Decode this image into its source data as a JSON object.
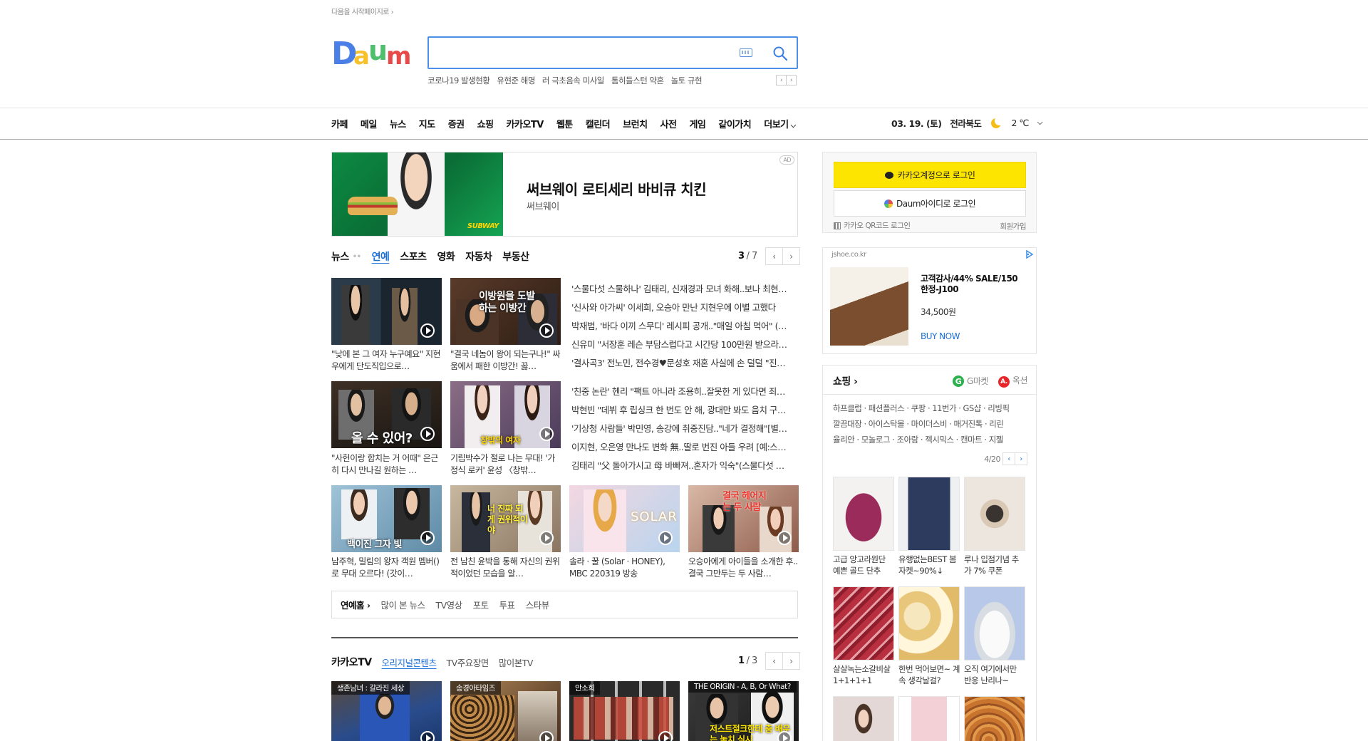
{
  "top": {
    "homepage_link": "다음을 시작페이지로 ›",
    "logo_text": "Daum",
    "search_placeholder": ""
  },
  "trending": [
    "코로나19 발생현황",
    "유현준 해명",
    "러 극초음속 미사일",
    "톰히들스턴 약혼",
    "놀토 규현"
  ],
  "gnb": [
    "카페",
    "메일",
    "뉴스",
    "지도",
    "증권",
    "쇼핑",
    "카카오TV",
    "웹툰",
    "캘린더",
    "브런치",
    "사전",
    "게임",
    "같이가치",
    "더보기"
  ],
  "weather": {
    "date": "03. 19. (토)",
    "region": "전라북도",
    "temp": "2 ℃"
  },
  "ad": {
    "title": "써브웨이 로티세리 바비큐 치킨",
    "sub": "써브웨이",
    "badge": "AD",
    "logo": "SUBWAY"
  },
  "news": {
    "tabs": [
      "뉴스",
      "연예",
      "스포츠",
      "영화",
      "자동차",
      "부동산"
    ],
    "active_tab": "연예",
    "page_current": "3",
    "page_total": "/ 7",
    "cards_row1": [
      {
        "caption": "\"낮에 본 그 여자 누구예요\" 지현우에게 단도직입으로…"
      },
      {
        "caption": "\"결국 네놈이 왕이 되는구나!\" 싸움에서 패한 이방간! 꿇…"
      }
    ],
    "cards_row2": [
      {
        "caption": "\"사헌이랑 합치는 거 어때\" 은근히 다시 만나길 원하는 …"
      },
      {
        "caption": "기립박수가 절로 나는 무대! '가정식 로커' 윤성 〈창밖…"
      }
    ],
    "headlines_a": [
      "'스물다섯 스물하나' 김태리, 신재경과 모녀 화해..보나 최현…",
      "'신사와 아가씨' 이세희, 오승아 만난 지현우에 이별 고했다",
      "박재범, '바다 이끼 스무디' 레시피 공개..\"매일 아침 먹어\" (…",
      "신유미 \"서장훈 레슨 부담스럽다고 시간당 100만원 받으라…",
      "'결사곡3' 전노민, 전수경♥문성호 재혼 사실에 손 덜덜 \"진…"
    ],
    "headlines_b": [
      "'친중 논란' 헨리 \"팩트 아니라 조용히..잘못한 게 있다면 죄…",
      "박현빈 \"데뷔 후 립싱크 한 번도 안 해, 광대만 봐도 음치 구…",
      "'기상청 사람들' 박민영, 송강에 취중진담..\"네가 결정해\"[별…",
      "이지현, 오은영 만나도 변화 無..딸로 번진 아들 우려 [예:스…",
      "김태리 \"父 돌아가시고 母 바빠져..혼자가 익숙\"(스물다섯 …"
    ],
    "cards_row3": [
      {
        "caption": "남주혁, 밀림의 왕자 객원 멤버()로 무대 오르다! (갓이…"
      },
      {
        "caption": "전 남친 윤박을 통해 자신의 권위적이었던 모습을 알…"
      },
      {
        "caption": "솔라 · 꿀 (Solar · HONEY), MBC 220319 방송"
      },
      {
        "caption": "오승아에게 아이들을 소개한 후.. 결국 그만두는 두 사람…"
      }
    ],
    "thumb_texts": [
      "이방원을 도발하는 이방간",
      "올 수 있어?",
      "창밖의 여자",
      "백이진 그자 빛",
      "너 진짜 되게 권위적이야",
      "SOLAR",
      "결국 헤어지는 두 사람"
    ]
  },
  "ent_bar": [
    "연예홈 ›",
    "많이 본 뉴스",
    "TV영상",
    "포토",
    "투표",
    "스타뷰"
  ],
  "kakaotv": {
    "title": "카카오TV",
    "tabs": [
      "오리지널콘텐츠",
      "TV주요장면",
      "많이본TV"
    ],
    "page_current": "1",
    "page_total": "/ 3",
    "thumbs": [
      "생존남녀 : 갈라진 세상",
      "송경아타임즈",
      "안소희",
      "THE ORIGIN - A, B, Or What?"
    ],
    "thumb_text": "저스트절크한테 춤 배우는 놓치 실시"
  },
  "login": {
    "kakao": "카카오계정으로 로그인",
    "daum": "Daum아이디로 로그인",
    "qr": "카카오 QR코드 로그인",
    "signup": "회원가입"
  },
  "right_ad": {
    "domain": "jshoe.co.kr",
    "title": "고객감사/44% SALE/150 한정-J100",
    "price": "34,500원",
    "buy": "BUY NOW"
  },
  "shopping": {
    "title": "쇼핑 ›",
    "gmarket": "G마켓",
    "auction": "옥션",
    "rows": [
      "하프클럽 · 패션플러스 · 쿠팡 · 11번가 · GS샵 · 리빙픽",
      "깔끔대장 · 아이스탁몰 · 마이더스비 · 매거진톡 · 리린",
      "율리안 · 모놀로그 · 조아람 · 젝시믹스 · 캔마트 · 지젤"
    ],
    "page": "4/20",
    "products": [
      {
        "caption": "고급 앙고라원단 예쁜 골드 단추",
        "color": "#9b2b5a"
      },
      {
        "caption": "유행없는BEST 봄자켓~90%↓",
        "color": "#2d3b5e"
      },
      {
        "caption": "루나 입점기념 추가 7% 쿠폰",
        "color": "#e4ddd3"
      },
      {
        "caption": "살살녹는소갈비살 1+1+1+1",
        "color": "#b8303f"
      },
      {
        "caption": "한번 먹어보면~ 계속 생각날걸?",
        "color": "#e8c77a"
      },
      {
        "caption": "오직 여기에서만 반응 난리나~",
        "color": "#d8dde3"
      }
    ]
  },
  "colors": {
    "accent": "#1a6fd8",
    "kakao_yellow": "#fee500",
    "search_border": "#4b8fe6"
  }
}
